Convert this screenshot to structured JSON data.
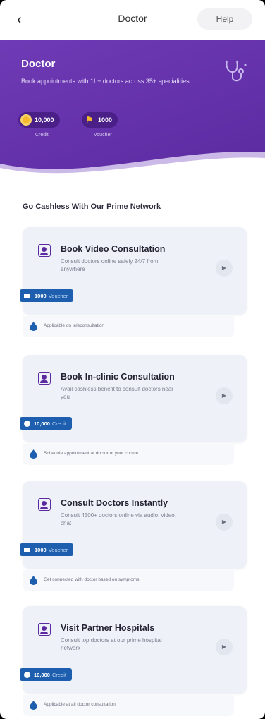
{
  "header": {
    "back_icon": "back-arrow-icon",
    "title": "Doctor",
    "help_label": "Help"
  },
  "hero": {
    "title": "Doctor",
    "subtitle": "Book appointments with 1L+ doctors across 35+ specialities",
    "credits": {
      "value": "10,000",
      "label": "Credit"
    },
    "voucher": {
      "value": "1000",
      "label": "Voucher"
    },
    "bg_color": "#5b2aa0"
  },
  "section_title": "Go Cashless With Our Prime Network",
  "cards": [
    {
      "title": "Book Video Consultation",
      "desc": "Consult doctors online safely 24/7 from anywhere",
      "badge_value": "1000",
      "badge_unit": "Voucher",
      "badge_icon": "ticket-icon",
      "note": "Applicable on teleconsultation"
    },
    {
      "title": "Book In-clinic Consultation",
      "desc": "Avail cashless benefit to consult doctors near you",
      "badge_value": "10,000",
      "badge_unit": "Credit",
      "badge_icon": "coin-icon",
      "note": "Schedule appointment at doctor of your choice"
    },
    {
      "title": "Consult Doctors Instantly",
      "desc": "Consult 4500+ doctors online via audio, video, chat",
      "badge_value": "1000",
      "badge_unit": "Voucher",
      "badge_icon": "ticket-icon",
      "note": "Get connected with doctor based on symptoms"
    },
    {
      "title": "Visit Partner Hospitals",
      "desc": "Consult top doctors at our prime hospital network",
      "badge_value": "10,000",
      "badge_unit": "Credit",
      "badge_icon": "coin-icon",
      "note": "Applicable at all doctor consultation"
    }
  ]
}
